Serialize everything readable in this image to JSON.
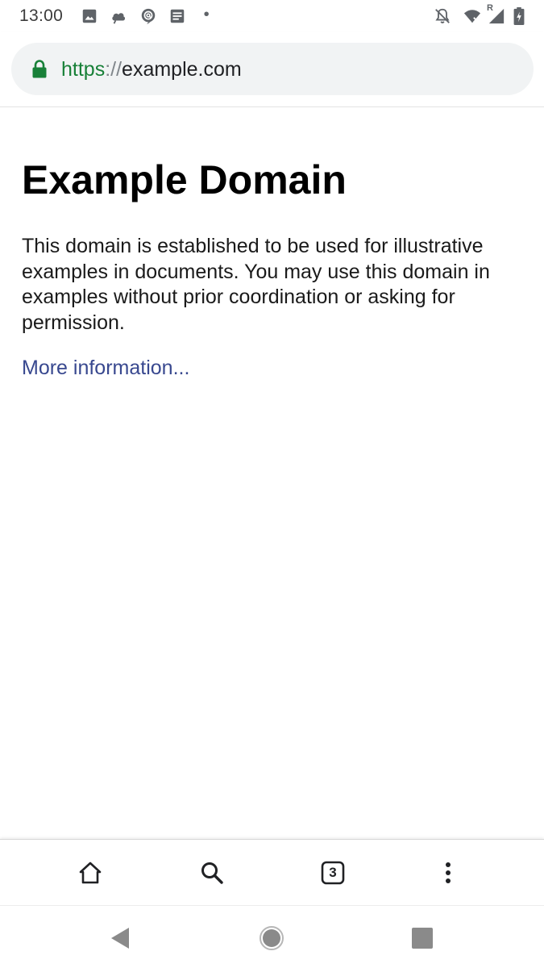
{
  "status_bar": {
    "time": "13:00",
    "left_icons": [
      "image-icon",
      "cloud-icon",
      "at-sign-icon",
      "document-icon",
      "dot-icon"
    ],
    "right_icons": [
      "bell-off-icon",
      "wifi-icon",
      "signal-icon",
      "battery-charging-icon"
    ],
    "roaming_indicator": "R"
  },
  "address_bar": {
    "icon": "lock-icon",
    "scheme": "https",
    "separator": "://",
    "host": "example.com",
    "colors": {
      "secure": "#188038",
      "separator": "#80868b",
      "host": "#202124"
    }
  },
  "page": {
    "title": "Example Domain",
    "body": "This domain is established to be used for illustrative examples in documents. You may use this domain in examples without prior coordination or asking for permission.",
    "link_text": "More information...",
    "link_color": "#38488f"
  },
  "bottom_toolbar": {
    "tab_count": "3",
    "icons": [
      "home-icon",
      "search-icon",
      "tab-switcher-icon",
      "more-vertical-icon"
    ]
  },
  "navigation_bar": {
    "icons": [
      "back-icon",
      "home-circle-icon",
      "recents-icon"
    ]
  }
}
